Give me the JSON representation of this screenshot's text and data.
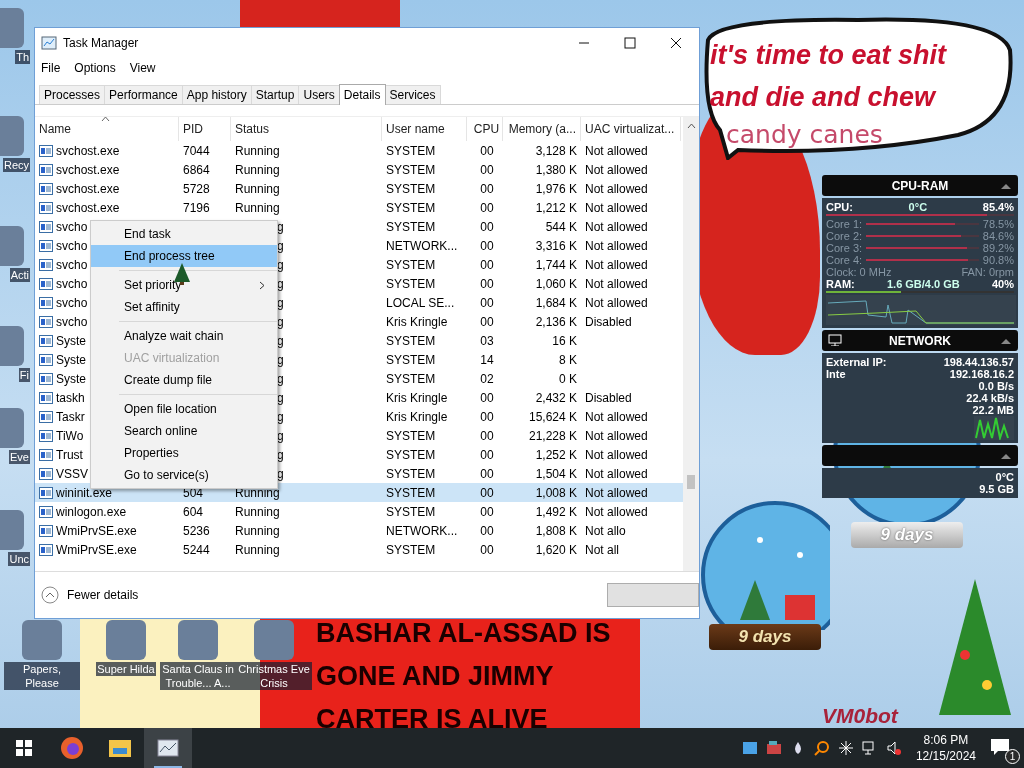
{
  "wallpaper": {
    "bubble_lines": [
      "it's time to eat shit",
      "and die and chew"
    ],
    "bubble_tail": "candy canes",
    "banner_lines": [
      "BASHAR AL-ASSAD IS",
      "GONE AND JIMMY",
      "CARTER IS ALIVE"
    ],
    "signature": "VM0bot"
  },
  "desktop_icons": [
    {
      "label": "Th",
      "kind": "edge"
    },
    {
      "label": "Recy",
      "kind": "edge"
    },
    {
      "label": "Acti",
      "kind": "edge"
    },
    {
      "label": "Fi",
      "kind": "edge"
    },
    {
      "label": "Eve",
      "kind": "edge"
    },
    {
      "label": "Unc",
      "kind": "edge"
    },
    {
      "label": "Papers, Please",
      "kind": "row"
    },
    {
      "label": "Super Hilda",
      "kind": "row"
    },
    {
      "label": "Santa Claus in Trouble... A...",
      "kind": "row"
    },
    {
      "label": "Christmas Eve Crisis",
      "kind": "row"
    }
  ],
  "snow_globes": [
    {
      "caption": "9 days"
    },
    {
      "caption": "9 days"
    }
  ],
  "task_manager": {
    "title": "Task Manager",
    "menu": [
      "File",
      "Options",
      "View"
    ],
    "tabs": [
      {
        "label": "Processes",
        "selected": false
      },
      {
        "label": "Performance",
        "selected": false
      },
      {
        "label": "App history",
        "selected": false
      },
      {
        "label": "Startup",
        "selected": false
      },
      {
        "label": "Users",
        "selected": false
      },
      {
        "label": "Details",
        "selected": true
      },
      {
        "label": "Services",
        "selected": false
      }
    ],
    "columns": [
      "Name",
      "PID",
      "Status",
      "User name",
      "CPU",
      "Memory (a...",
      "UAC virtualizat..."
    ],
    "rows": [
      {
        "name": "svchost.exe",
        "pid": "7044",
        "status": "Running",
        "user": "SYSTEM",
        "cpu": "00",
        "memory": "3,128 K",
        "uac": "Not allowed",
        "selected": false
      },
      {
        "name": "svchost.exe",
        "pid": "6864",
        "status": "Running",
        "user": "SYSTEM",
        "cpu": "00",
        "memory": "1,380 K",
        "uac": "Not allowed",
        "selected": false
      },
      {
        "name": "svchost.exe",
        "pid": "5728",
        "status": "Running",
        "user": "SYSTEM",
        "cpu": "00",
        "memory": "1,976 K",
        "uac": "Not allowed",
        "selected": false
      },
      {
        "name": "svchost.exe",
        "pid": "7196",
        "status": "Running",
        "user": "SYSTEM",
        "cpu": "00",
        "memory": "1,212 K",
        "uac": "Not allowed",
        "selected": false
      },
      {
        "name": "svcho",
        "status": "g",
        "user": "SYSTEM",
        "cpu": "00",
        "memory": "544 K",
        "uac": "Not allowed",
        "selected": false
      },
      {
        "name": "svcho",
        "status": "g",
        "user": "NETWORK...",
        "cpu": "00",
        "memory": "3,316 K",
        "uac": "Not allowed",
        "selected": false
      },
      {
        "name": "svcho",
        "status": "g",
        "user": "SYSTEM",
        "cpu": "00",
        "memory": "1,744 K",
        "uac": "Not allowed",
        "selected": false
      },
      {
        "name": "svcho",
        "status": "g",
        "user": "SYSTEM",
        "cpu": "00",
        "memory": "1,060 K",
        "uac": "Not allowed",
        "selected": false
      },
      {
        "name": "svcho",
        "status": "g",
        "user": "LOCAL SE...",
        "cpu": "00",
        "memory": "1,684 K",
        "uac": "Not allowed",
        "selected": false
      },
      {
        "name": "svcho",
        "status": "g",
        "user": "Kris Kringle",
        "cpu": "00",
        "memory": "2,136 K",
        "uac": "Disabled",
        "selected": false
      },
      {
        "name": "Syste",
        "status": "g",
        "user": "SYSTEM",
        "cpu": "03",
        "memory": "16 K",
        "selected": false
      },
      {
        "name": "Syste",
        "status": "g",
        "user": "SYSTEM",
        "cpu": "14",
        "memory": "8 K",
        "selected": false
      },
      {
        "name": "Syste",
        "status": "g",
        "user": "SYSTEM",
        "cpu": "02",
        "memory": "0 K",
        "selected": false
      },
      {
        "name": "taskh",
        "status": "g",
        "user": "Kris Kringle",
        "cpu": "00",
        "memory": "2,432 K",
        "uac": "Disabled",
        "selected": false
      },
      {
        "name": "Taskr",
        "status": "g",
        "user": "Kris Kringle",
        "cpu": "00",
        "memory": "15,624 K",
        "uac": "Not allowed",
        "selected": false
      },
      {
        "name": "TiWo",
        "status": "g",
        "user": "SYSTEM",
        "cpu": "00",
        "memory": "21,228 K",
        "uac": "Not allowed",
        "selected": false
      },
      {
        "name": "Trust",
        "status": "g",
        "user": "SYSTEM",
        "cpu": "00",
        "memory": "1,252 K",
        "uac": "Not allowed",
        "selected": false
      },
      {
        "name": "VSSV",
        "status": "g",
        "user": "SYSTEM",
        "cpu": "00",
        "memory": "1,504 K",
        "uac": "Not allowed",
        "selected": false
      },
      {
        "name": "wininit.exe",
        "pid": "504",
        "status": "Running",
        "user": "SYSTEM",
        "cpu": "00",
        "memory": "1,008 K",
        "uac": "Not allowed",
        "selected": true
      },
      {
        "name": "winlogon.exe",
        "pid": "604",
        "status": "Running",
        "user": "SYSTEM",
        "cpu": "00",
        "memory": "1,492 K",
        "uac": "Not allowed",
        "selected": false
      },
      {
        "name": "WmiPrvSE.exe",
        "pid": "5236",
        "status": "Running",
        "user": "NETWORK...",
        "cpu": "00",
        "memory": "1,808 K",
        "uac": "Not allo",
        "selected": false
      },
      {
        "name": "WmiPrvSE.exe",
        "pid": "5244",
        "status": "Running",
        "user": "SYSTEM",
        "cpu": "00",
        "memory": "1,620 K",
        "uac": "Not all",
        "selected": false
      }
    ],
    "footer": "Fewer details"
  },
  "context_menu": {
    "groups": [
      [
        {
          "label": "End task",
          "selected": false,
          "disabled": false,
          "submenu": false
        },
        {
          "label": "End process tree",
          "selected": true,
          "disabled": false,
          "submenu": false
        }
      ],
      [
        {
          "label": "Set priority",
          "selected": false,
          "disabled": false,
          "submenu": true
        },
        {
          "label": "Set affinity",
          "selected": false,
          "disabled": false,
          "submenu": false
        }
      ],
      [
        {
          "label": "Analyze wait chain",
          "selected": false,
          "disabled": false,
          "submenu": false
        },
        {
          "label": "UAC virtualization",
          "selected": false,
          "disabled": true,
          "submenu": false
        },
        {
          "label": "Create dump file",
          "selected": false,
          "disabled": false,
          "submenu": false
        }
      ],
      [
        {
          "label": "Open file location",
          "selected": false,
          "disabled": false,
          "submenu": false
        },
        {
          "label": "Search online",
          "selected": false,
          "disabled": false,
          "submenu": false
        },
        {
          "label": "Properties",
          "selected": false,
          "disabled": false,
          "submenu": false
        },
        {
          "label": "Go to service(s)",
          "selected": false,
          "disabled": false,
          "submenu": false
        }
      ]
    ]
  },
  "gadget": {
    "cpu_title": "CPU-RAM",
    "cpu_label": "CPU:",
    "cpu_temp": "0°C",
    "cpu_value": "85.4%",
    "cpu_bar": {
      "level": 0.854
    },
    "cores": [
      {
        "label": "Core 1:",
        "value": "78.5%",
        "level": 0.785
      },
      {
        "label": "Core 2:",
        "value": "84.6%",
        "level": 0.846
      },
      {
        "label": "Core 3:",
        "value": "89.2%",
        "level": 0.892
      },
      {
        "label": "Core 4:",
        "value": "90.8%",
        "level": 0.908
      }
    ],
    "clock": "Clock: 0 MHz",
    "fan": "FAN: 0rpm",
    "ram_label": "RAM:",
    "ram_value": "1.6 GB/4.0 GB",
    "ram_percent": "40%",
    "ram_bar": {
      "level": 0.4
    },
    "network_title": "NETWORK",
    "external_ip_label": "External IP:",
    "external_ip": "198.44.136.57",
    "internal_label": "Inte",
    "internal_ip": "192.168.16.2",
    "net_values": [
      "0.0 B/s",
      "22.4 kB/s",
      "22.2 MB"
    ],
    "third_values": [
      "0°C",
      "9.5 GB"
    ]
  },
  "taskbar": {
    "time": "8:06 PM",
    "date": "12/15/2024",
    "notifications": "1"
  }
}
